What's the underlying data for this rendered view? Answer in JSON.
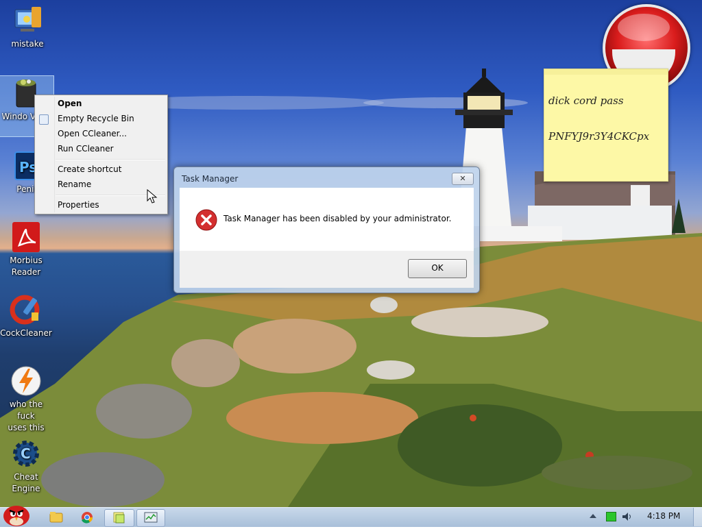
{
  "desktop_icons": [
    {
      "label": "mistake",
      "icon": "monitor-folder-icon"
    },
    {
      "label": "Windows Vista",
      "icon": "recycle-bin-icon"
    },
    {
      "label": "Penis",
      "icon": "photoshop-icon"
    },
    {
      "label": "Morbius Reader",
      "icon": "pdf-reader-icon"
    },
    {
      "label": "CockCleaner",
      "icon": "ccleaner-icon"
    },
    {
      "label": "who the fuck uses this",
      "icon": "winamp-lightning-icon"
    },
    {
      "label": "Cheat Engine",
      "icon": "cheat-engine-icon"
    }
  ],
  "icon_labels_visible": {
    "mistake": "mistake",
    "windows_vista": "Windo Vista",
    "penis": "Penis",
    "morbius": "Morbius\nReader",
    "cockcleaner": "CockCleaner",
    "who": "who the fuck\nuses this",
    "cheat": "Cheat\nEngine"
  },
  "context_menu": {
    "items": [
      "Open",
      "Empty Recycle Bin",
      "Open CCleaner...",
      "Run CCleaner",
      "Create shortcut",
      "Rename",
      "Properties"
    ]
  },
  "dialog": {
    "title": "Task Manager",
    "close_label": "✕",
    "message": "Task Manager has been disabled by your administrator.",
    "ok_label": "OK",
    "icon": "error-icon"
  },
  "sticky_note": {
    "line1": "dick cord pass",
    "line2": "PNFYJ9r3Y4CKCpx"
  },
  "taskbar": {
    "time": "4:18 PM",
    "pinned": [
      "angry-birds-start-icon",
      "explorer-folder-icon",
      "chrome-icon",
      "sticky-notes-icon",
      "task-manager-icon"
    ]
  },
  "colors": {
    "error_red": "#d32f2f",
    "note_yellow": "#fdf8a6",
    "gadget_red": "#d91c1c"
  }
}
